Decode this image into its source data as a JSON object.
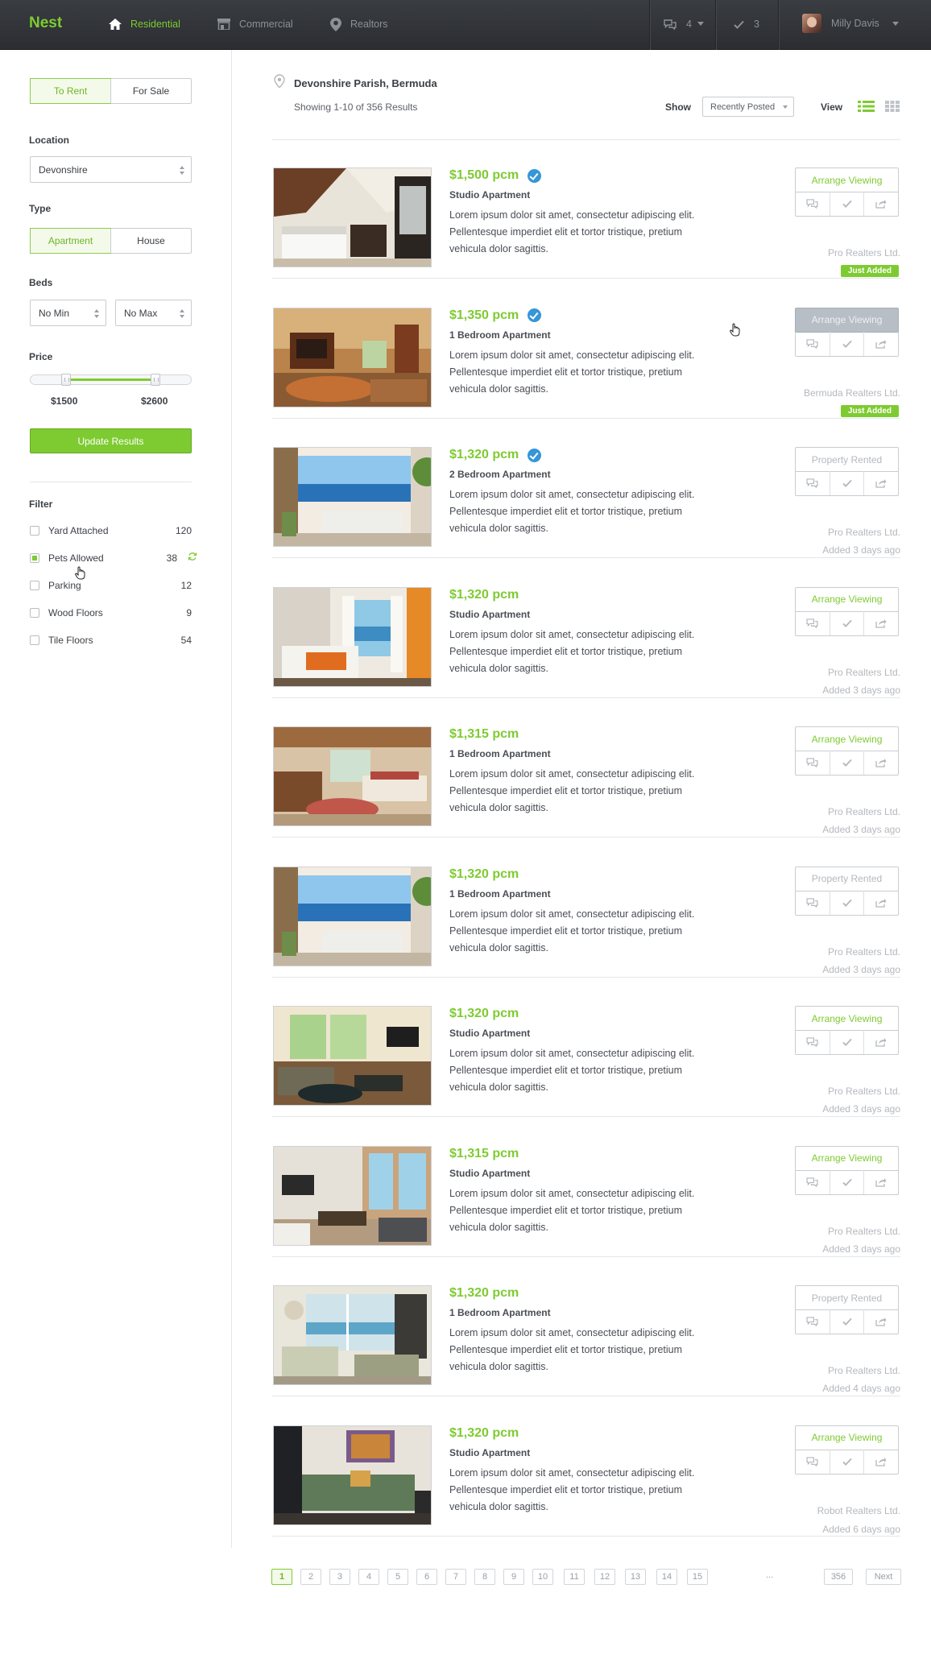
{
  "header": {
    "logo": "Nest",
    "nav": [
      {
        "label": "Residential",
        "icon": "home-icon",
        "active": true
      },
      {
        "label": "Commercial",
        "icon": "storefront-icon",
        "active": false
      },
      {
        "label": "Realtors",
        "icon": "realtor-pin-icon",
        "active": false
      }
    ],
    "messages_count": "4",
    "saved_count": "3",
    "user_name": "Milly Davis"
  },
  "sidebar": {
    "mode_tabs": [
      "To Rent",
      "For Sale"
    ],
    "location_label": "Location",
    "location_value": "Devonshire",
    "type_label": "Type",
    "type_tabs": [
      "Apartment",
      "House"
    ],
    "beds_label": "Beds",
    "beds_min": "No Min",
    "beds_max": "No Max",
    "price_label": "Price",
    "price_min": "$1500",
    "price_max": "$2600",
    "price_range_fraction": [
      0.22,
      0.78
    ],
    "update_button": "Update Results",
    "filter_label": "Filter",
    "filters": [
      {
        "label": "Yard Attached",
        "count": "120",
        "checked": false
      },
      {
        "label": "Pets Allowed",
        "count": "38",
        "checked": true
      },
      {
        "label": "Parking",
        "count": "12",
        "checked": false
      },
      {
        "label": "Wood Floors",
        "count": "9",
        "checked": false
      },
      {
        "label": "Tile Floors",
        "count": "54",
        "checked": false
      }
    ]
  },
  "main": {
    "location_title": "Devonshire Parish, Bermuda",
    "results_text": "Showing 1-10 of 356 Results",
    "show_label": "Show",
    "sort_value": "Recently Posted",
    "view_label": "View",
    "description": "Lorem ipsum dolor sit amet, consectetur adipiscing elit. Pellentesque imperdiet elit et tortor tristique, pretium vehicula dolor sagittis.",
    "listings": [
      {
        "price": "$1,500 pcm",
        "verified": true,
        "type": "Studio Apartment",
        "action": "Arrange Viewing",
        "action_state": "arrange",
        "realtor": "Pro Realters Ltd.",
        "status": "Just Added",
        "status_is_badge": true,
        "photo": "bedroom-white"
      },
      {
        "price": "$1,350 pcm",
        "verified": true,
        "type": "1 Bedroom Apartment",
        "action": "Arrange Viewing",
        "action_state": "arrange-hover",
        "realtor": "Bermuda Realters Ltd.",
        "status": "Just Added",
        "status_is_badge": true,
        "photo": "living-warm"
      },
      {
        "price": "$1,320 pcm",
        "verified": true,
        "type": "2 Bedroom Apartment",
        "action": "Property Rented",
        "action_state": "rented",
        "realtor": "Pro Realters Ltd.",
        "status": "Added 3 days ago",
        "status_is_badge": false,
        "photo": "ocean-patio"
      },
      {
        "price": "$1,320 pcm",
        "verified": false,
        "type": "Studio Apartment",
        "action": "Arrange Viewing",
        "action_state": "arrange",
        "realtor": "Pro Realters Ltd.",
        "status": "Added 3 days ago",
        "status_is_badge": false,
        "photo": "bedroom-orange"
      },
      {
        "price": "$1,315 pcm",
        "verified": false,
        "type": "1 Bedroom Apartment",
        "action": "Arrange Viewing",
        "action_state": "arrange",
        "realtor": "Pro Realters Ltd.",
        "status": "Added 3 days ago",
        "status_is_badge": false,
        "photo": "bedroom-wood"
      },
      {
        "price": "$1,320 pcm",
        "verified": false,
        "type": "1 Bedroom Apartment",
        "action": "Property Rented",
        "action_state": "rented",
        "realtor": "Pro Realters Ltd.",
        "status": "Added 3 days ago",
        "status_is_badge": false,
        "photo": "ocean-patio"
      },
      {
        "price": "$1,320 pcm",
        "verified": false,
        "type": "Studio Apartment",
        "action": "Arrange Viewing",
        "action_state": "arrange",
        "realtor": "Pro Realters Ltd.",
        "status": "Added 3 days ago",
        "status_is_badge": false,
        "photo": "living-sofa"
      },
      {
        "price": "$1,315 pcm",
        "verified": false,
        "type": "Studio Apartment",
        "action": "Arrange Viewing",
        "action_state": "arrange",
        "realtor": "Pro Realters Ltd.",
        "status": "Added 3 days ago",
        "status_is_badge": false,
        "photo": "living-doors"
      },
      {
        "price": "$1,320 pcm",
        "verified": false,
        "type": "1 Bedroom Apartment",
        "action": "Property Rented",
        "action_state": "rented",
        "realtor": "Pro Realters Ltd.",
        "status": "Added 4 days ago",
        "status_is_badge": false,
        "photo": "sunroom"
      },
      {
        "price": "$1,320 pcm",
        "verified": false,
        "type": "Studio Apartment",
        "action": "Arrange Viewing",
        "action_state": "arrange",
        "realtor": "Robot Realters Ltd.",
        "status": "Added 6 days ago",
        "status_is_badge": false,
        "photo": "living-green"
      }
    ]
  },
  "pagination": {
    "pages": [
      "1",
      "2",
      "3",
      "4",
      "5",
      "6",
      "7",
      "8",
      "9",
      "10",
      "11",
      "12",
      "13",
      "14",
      "15"
    ],
    "current": "1",
    "ellipsis": "...",
    "last": "356",
    "next": "Next"
  },
  "colors": {
    "accent": "#7ecb31",
    "verified": "#3596d8",
    "topbar": "#2e3034"
  }
}
